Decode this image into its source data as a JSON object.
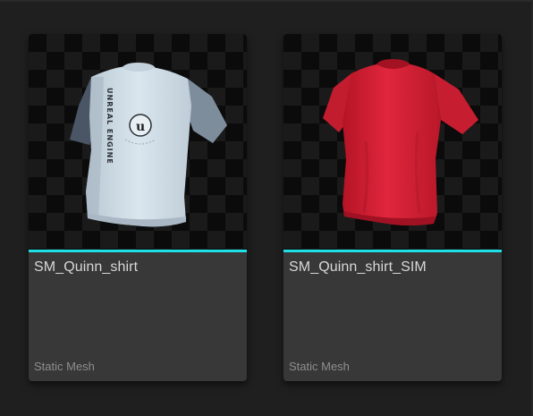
{
  "colors": {
    "accent": "#1fe0e6",
    "shirt_white": "#d3e1eb",
    "shirt_sleeve": "#6c7c8d",
    "shirt_red": "#d71f35"
  },
  "assets": [
    {
      "name": "SM_Quinn_shirt",
      "type": "Static Mesh",
      "thumbnail_icon": "white-tshirt-unreal-engine-icon"
    },
    {
      "name": "SM_Quinn_shirt_SIM",
      "type": "Static Mesh",
      "thumbnail_icon": "red-tshirt-icon"
    }
  ]
}
